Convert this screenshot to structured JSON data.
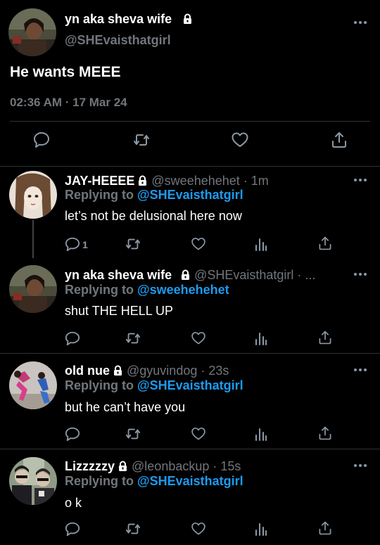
{
  "main_tweet": {
    "display_name": "yn aka sheva wife",
    "handle": "@SHEvaisthatgirl",
    "text": "He wants MEEE",
    "timestamp": "02:36 AM · 17 Mar 24"
  },
  "replies": [
    {
      "display_name": "JAY-HEEEE",
      "handle_time": "@sweehehehet · 1m",
      "replying_prefix": "Replying to",
      "replying_to": "@SHEvaisthatgirl",
      "text": "let’s not be delusional here now",
      "reply_count": "1"
    },
    {
      "display_name": "yn aka sheva wife",
      "handle_time": "@SHEvaisthatgirl · ...",
      "replying_prefix": "Replying to",
      "replying_to": "@sweehehehet",
      "text": "shut THE HELL UP",
      "reply_count": ""
    },
    {
      "display_name": "old nue",
      "handle_time": "@gyuvindog · 23s",
      "replying_prefix": "Replying to",
      "replying_to": "@SHEvaisthatgirl",
      "text": "but he can’t have you",
      "reply_count": ""
    },
    {
      "display_name": "Lizzzzzy",
      "handle_time": "@leonbackup · 15s",
      "replying_prefix": "Replying to",
      "replying_to": "@SHEvaisthatgirl",
      "text": "o k",
      "reply_count": ""
    }
  ],
  "icons": {
    "reply": "reply-icon",
    "retweet": "retweet-icon",
    "like": "like-icon",
    "views": "views-icon",
    "share": "share-icon",
    "lock": "lock-icon",
    "more": "more-icon"
  },
  "colors": {
    "background": "#000000",
    "link": "#1d9bf0",
    "muted": "#71767b",
    "divider": "#2f3336"
  }
}
